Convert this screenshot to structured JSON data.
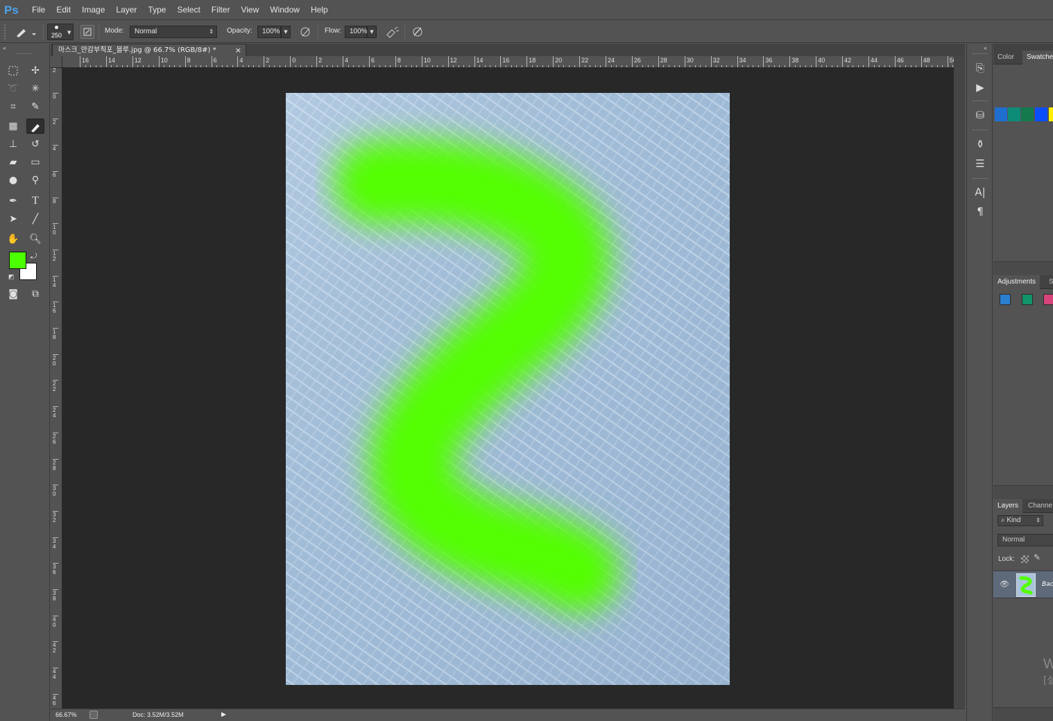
{
  "app": {
    "logo": "Ps"
  },
  "menu": [
    "File",
    "Edit",
    "Image",
    "Layer",
    "Type",
    "Select",
    "Filter",
    "View",
    "Window",
    "Help"
  ],
  "options_bar": {
    "brush_size": "250",
    "mode_label": "Mode:",
    "mode_value": "Normal",
    "opacity_label": "Opacity:",
    "opacity_value": "100%",
    "flow_label": "Flow:",
    "flow_value": "100%"
  },
  "document": {
    "tab_title": "마스크_안감부직포_블루.jpg @ 66.7% (RGB/8#) *",
    "close_glyph": "×",
    "zoom": "66.67%",
    "doc_size": "Doc: 3.52M/3.52M"
  },
  "ruler_h_labels": [
    "16",
    "14",
    "12",
    "10",
    "8",
    "6",
    "4",
    "2",
    "0",
    "2",
    "4",
    "6",
    "8",
    "10",
    "12",
    "14",
    "16",
    "18",
    "20",
    "22",
    "24",
    "26",
    "28",
    "30",
    "32",
    "34",
    "36",
    "38",
    "40",
    "42",
    "44",
    "46",
    "48",
    "50"
  ],
  "ruler_v_labels": [
    "2",
    "0",
    "2",
    "4",
    "6",
    "8",
    "10",
    "12",
    "14",
    "16",
    "18",
    "20",
    "22",
    "24",
    "26",
    "28",
    "30",
    "32",
    "34",
    "36",
    "38",
    "40",
    "42",
    "44",
    "46"
  ],
  "colors": {
    "foreground": "#4cff00",
    "background": "#ffffff",
    "canvas_base": "#a9c3dc",
    "paint": "#52ff00"
  },
  "panels": {
    "color_tab": "Color",
    "swatches_tab": "Swatche",
    "swatch_colors": [
      "#1f6fd1",
      "#0d8c78",
      "#147a4e",
      "#0a4eff",
      "#ffef00"
    ],
    "adjustments_tab": "Adjustments",
    "styles_tab": "S",
    "adjust_colors": [
      "#2a7fd0",
      "#11946a",
      "#d6447a"
    ],
    "layers_tab": "Layers",
    "channels_tab": "Channe",
    "kind_label": "Kind",
    "blend_mode": "Normal",
    "lock_label": "Lock:",
    "layer_name": "Bac"
  },
  "watermark": {
    "line1": "W",
    "line2": "[설"
  }
}
